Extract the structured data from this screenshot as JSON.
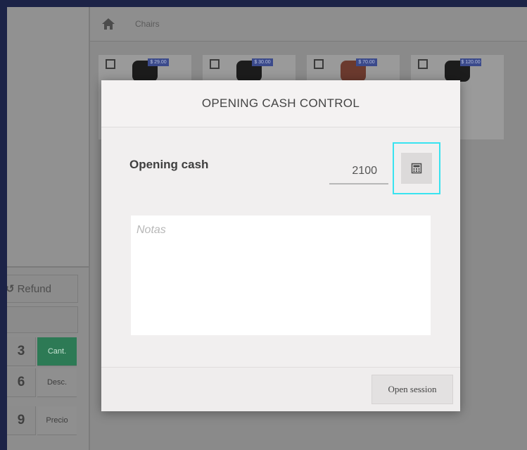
{
  "header": {
    "breadcrumb": "Chairs",
    "home_icon": "home-icon"
  },
  "products": [
    {
      "price": "$ 29.00"
    },
    {
      "price": "$ 30.00"
    },
    {
      "price": "$ 70.00"
    },
    {
      "price": "$ 120.00"
    }
  ],
  "actions": {
    "refund_label": "Refund",
    "refund_icon": "undo-icon"
  },
  "numpad": [
    {
      "key": "3",
      "mode": "Cant.",
      "active": true
    },
    {
      "key": "6",
      "mode": "Desc.",
      "active": false
    },
    {
      "key": "9",
      "mode": "Precio",
      "active": false
    }
  ],
  "modal": {
    "title": "OPENING CASH CONTROL",
    "opening_cash_label": "Opening cash",
    "opening_cash_value": "2100",
    "calculator_icon": "calculator-icon",
    "notes_placeholder": "Notas",
    "open_session_label": "Open session"
  },
  "colors": {
    "focus_ring": "#39e3f0",
    "active_mode": "#2d7a55",
    "price_badge": "#3b4a8b",
    "outer_background": "#1c2347"
  }
}
